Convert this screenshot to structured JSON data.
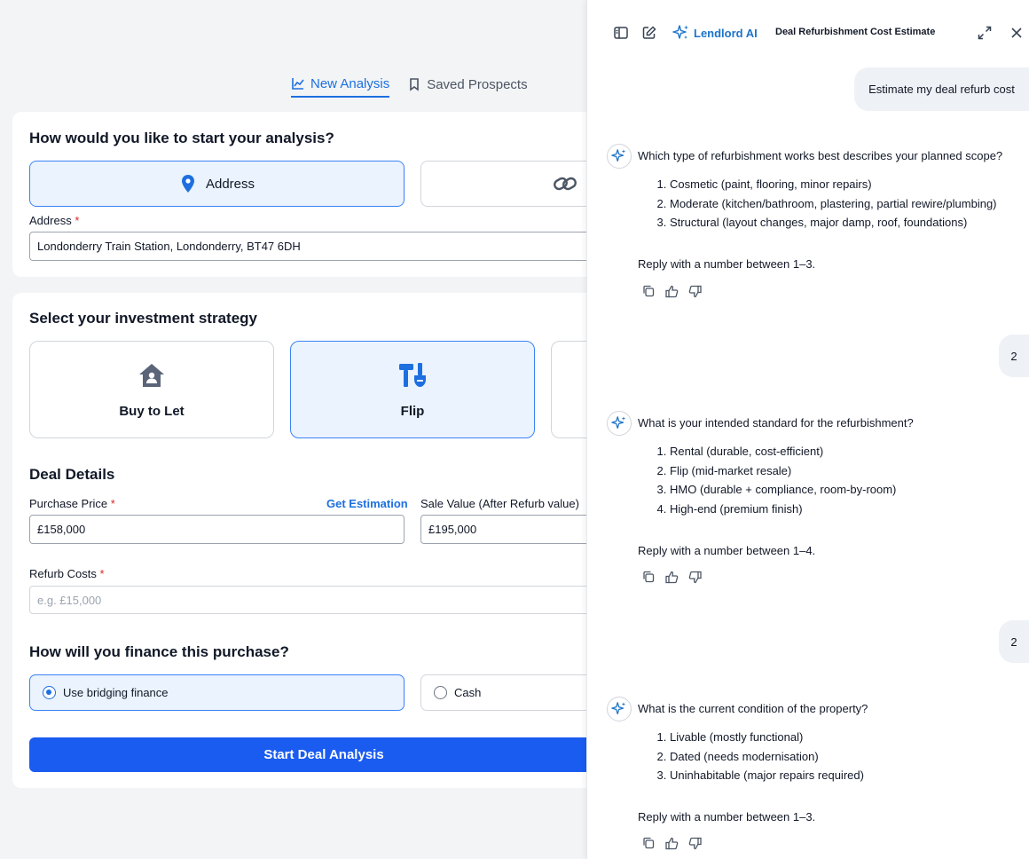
{
  "tabs": [
    {
      "label": "New Analysis",
      "active": true
    },
    {
      "label": "Saved Prospects",
      "active": false
    }
  ],
  "start": {
    "title": "How would you like to start your analysis?",
    "options": [
      {
        "label": "Address",
        "icon": "location-pin-icon",
        "selected": true
      },
      {
        "label": "",
        "icon": "link-icon",
        "selected": false
      }
    ],
    "address_label": "Address",
    "address_value": "Londonderry Train Station, Londonderry, BT47 6DH"
  },
  "strategy": {
    "title": "Select your investment strategy",
    "options": [
      {
        "label": "Buy to Let",
        "icon": "house-person-icon",
        "selected": false
      },
      {
        "label": "Flip",
        "icon": "hammer-brush-icon",
        "selected": true
      }
    ]
  },
  "deal": {
    "title": "Deal Details",
    "purchase_price_label": "Purchase Price",
    "get_estimation": "Get Estimation",
    "purchase_price_value": "£158,000",
    "sale_value_label": "Sale Value (After Refurb value)",
    "sale_value_value": "£195,000",
    "refurb_label": "Refurb Costs",
    "refurb_placeholder": "e.g. £15,000"
  },
  "finance": {
    "title": "How will you finance this purchase?",
    "options": [
      {
        "label": "Use bridging finance",
        "selected": true
      },
      {
        "label": "Cash",
        "selected": false
      }
    ]
  },
  "start_button": "Start Deal Analysis",
  "chat": {
    "brand": "Lendlord AI",
    "title": "Deal Refurbishment Cost Estimate",
    "accent": "#1d74c9",
    "messages": [
      {
        "role": "user",
        "text": "Estimate my deal refurb cost"
      },
      {
        "role": "bot",
        "question": "Which type of refurbishment works best describes your planned scope?",
        "items": [
          "Cosmetic (paint, flooring, minor repairs)",
          "Moderate (kitchen/bathroom, plastering, partial rewire/plumbing)",
          "Structural (layout changes, major damp, roof, foundations)"
        ],
        "reply": "Reply with a number between 1–3."
      },
      {
        "role": "user",
        "text": "2"
      },
      {
        "role": "bot",
        "question": "What is your intended standard for the refurbishment?",
        "items": [
          "Rental (durable, cost-efficient)",
          "Flip (mid-market resale)",
          "HMO (durable + compliance, room-by-room)",
          "High-end (premium finish)"
        ],
        "reply": "Reply with a number between 1–4."
      },
      {
        "role": "user",
        "text": "2"
      },
      {
        "role": "bot",
        "question": "What is the current condition of the property?",
        "items": [
          "Livable (mostly functional)",
          "Dated (needs modernisation)",
          "Uninhabitable (major repairs required)"
        ],
        "reply": "Reply with a number between 1–3."
      }
    ]
  }
}
